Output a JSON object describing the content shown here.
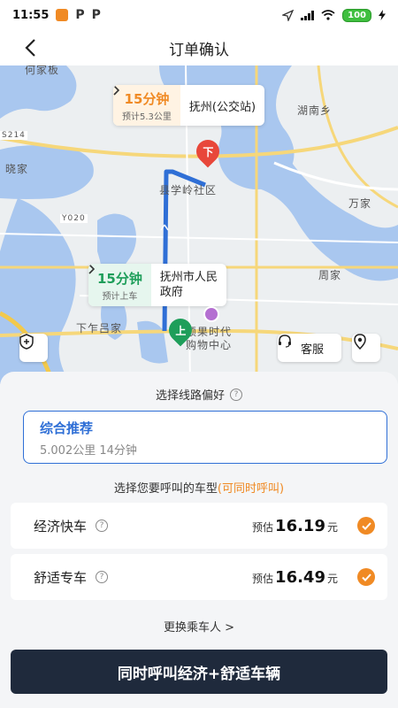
{
  "status_bar": {
    "time": "11:55",
    "battery": "100"
  },
  "header": {
    "title": "订单确认"
  },
  "map": {
    "labels": {
      "village_top": "何家板",
      "hunan_xiang": "湖南乡",
      "wanjia": "万家",
      "xiaojia": "晓家",
      "district": "县学岭社区",
      "zhoujia": "周家",
      "xiazuolv": "下乍吕家",
      "mall": "硕果时代\n购物中心",
      "road_s214": "S214",
      "road_y020": "Y020"
    },
    "destination": {
      "time": "15分钟",
      "sub": "预计5.3公里",
      "place": "抚州(公交站)"
    },
    "pickup": {
      "time": "15分钟",
      "sub": "预计上车",
      "place": "抚州市人民\n政府"
    },
    "pin_drop": "下",
    "pin_pick": "上",
    "kefu": "客服"
  },
  "sheet": {
    "pref_title": "选择线路偏好",
    "route": {
      "name": "综合推荐",
      "detail": "5.002公里 14分钟"
    },
    "cartype_title": "选择您要呼叫的车型",
    "cartype_hint": "(可同时呼叫)",
    "cars": [
      {
        "name": "经济快车",
        "est": "预估",
        "price": "16.19",
        "unit": "元"
      },
      {
        "name": "舒适专车",
        "est": "预估",
        "price": "16.49",
        "unit": "元"
      }
    ],
    "change_passenger": "更换乘车人 >",
    "call_button": "同时呼叫经济+舒适车辆"
  },
  "colors": {
    "route_blue": "#2f6fd6",
    "accent_orange": "#f08a24",
    "pickup_green": "#1e9e5a",
    "drop_red": "#e8473a",
    "button_dark": "#1f2a3c"
  }
}
